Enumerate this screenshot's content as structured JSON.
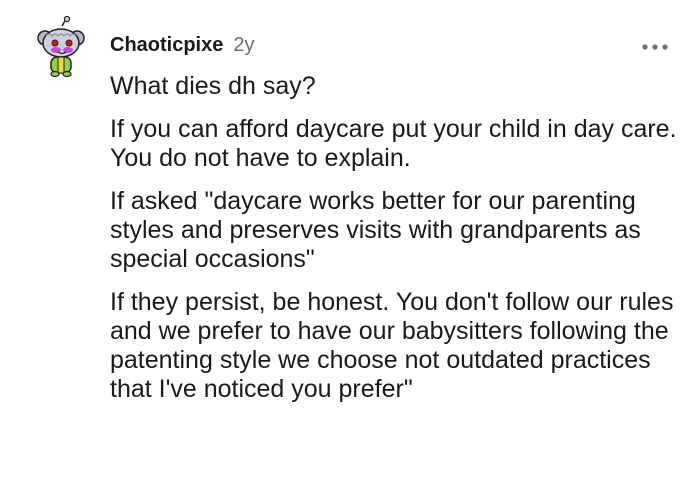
{
  "comment": {
    "username": "Chaoticpixe",
    "age": "2y",
    "paragraphs": [
      "What dies dh say?",
      "If you can afford daycare put your child in day care. You do not have to explain.",
      "If asked \"daycare works better for our parenting styles and preserves visits with grandparents as special occasions\"",
      "If they persist, be honest. You don't follow our rules and we prefer to have our babysitters following the patenting style we choose not outdated practices that I've noticed you prefer\""
    ],
    "icons": {
      "avatar": "snoo-avatar-icon",
      "more": "more-options-icon"
    }
  }
}
